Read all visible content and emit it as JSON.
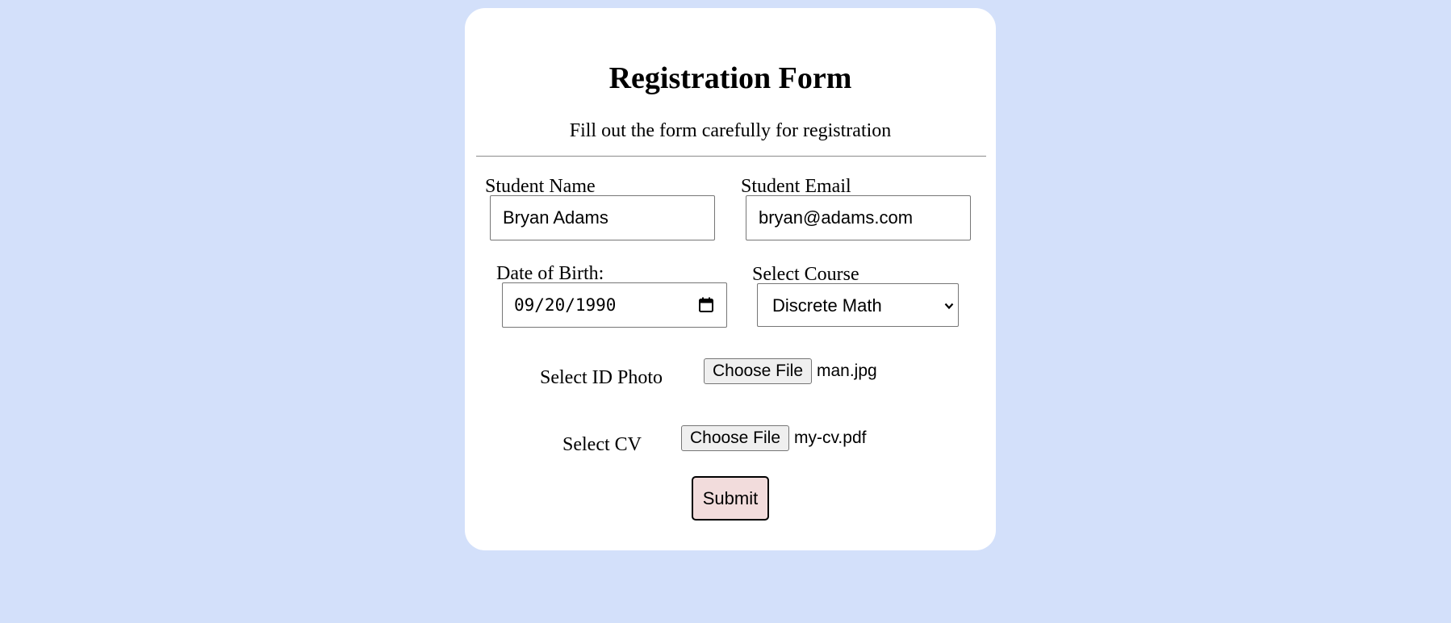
{
  "form": {
    "title": "Registration Form",
    "subtitle": "Fill out the form carefully for registration",
    "student_name": {
      "label": "Student Name",
      "value": "Bryan Adams"
    },
    "student_email": {
      "label": "Student Email",
      "value": "bryan@adams.com"
    },
    "date_of_birth": {
      "label": "Date of Birth:",
      "value": "09/20/1990"
    },
    "course": {
      "label": "Select Course",
      "selected": "Discrete Math"
    },
    "id_photo": {
      "label": "Select ID Photo",
      "button_label": "Choose File",
      "file_name": "man.jpg"
    },
    "cv": {
      "label": "Select CV",
      "button_label": "Choose File",
      "file_name": "my-cv.pdf"
    },
    "submit_label": "Submit"
  },
  "icons": {
    "calendar": "calendar-icon",
    "select_arrow": "chevron-down-icon"
  },
  "colors": {
    "page_background": "#d3e0fa",
    "card_background": "#ffffff",
    "submit_background": "#f2dcdc",
    "file_button_background": "#efefef"
  }
}
